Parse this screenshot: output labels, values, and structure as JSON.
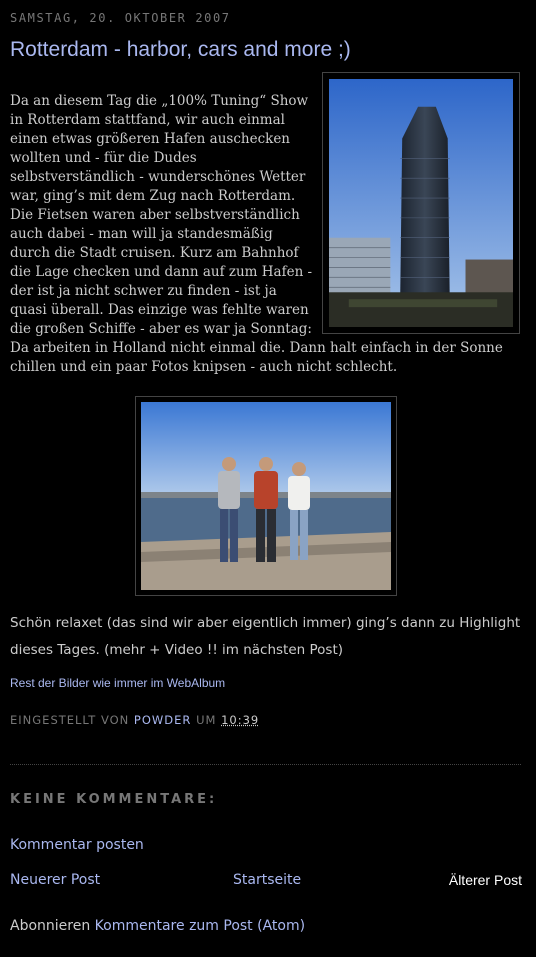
{
  "post": {
    "date": "Samstag, 20. Oktober 2007",
    "title": "Rotterdam - harbor, cars and more ;)",
    "paragraph1": "Da an diesem Tag die „100% Tuning“ Show in Rotterdam stattfand, wir auch einmal einen etwas größeren Hafen auschecken wollten und - für die Dudes selbstverständlich - wunderschönes Wetter war, ging’s mit dem Zug nach Rotterdam. Die Fietsen waren aber selbstverständlich auch dabei - man will ja standesmäßig durch die Stadt cruisen. Kurz am Bahnhof die Lage checken und dann auf zum Hafen - der ist ja nicht schwer zu finden - ist ja quasi überall. Das einzige was fehlte waren die großen Schiffe - aber es war ja Sonntag: Da arbeiten in Holland nicht einmal die. Dann halt einfach in der Sonne chillen und ein paar Fotos knipsen - auch nicht schlecht.",
    "paragraph2": "Schön relaxet (das sind wir aber eigentlich immer) ging’s dann zu Highlight dieses Tages. (mehr + Video !! im nächsten Post)",
    "album_link": "Rest der Bilder wie immer im WebAlbum"
  },
  "footer": {
    "posted_by": "Eingestellt von",
    "author": "Powder",
    "at": "um",
    "time": "10:39"
  },
  "comments": {
    "heading": "Keine Kommentare:",
    "post_comment": "Kommentar posten"
  },
  "nav": {
    "newer": "Neuerer Post",
    "home": "Startseite",
    "older": "Älterer Post"
  },
  "subscribe": {
    "label": "Abonnieren",
    "link": "Kommentare zum Post (Atom)"
  },
  "colors": {
    "background": "#000000",
    "link": "#aab8f0",
    "text": "#cccccc",
    "muted": "#777777"
  }
}
